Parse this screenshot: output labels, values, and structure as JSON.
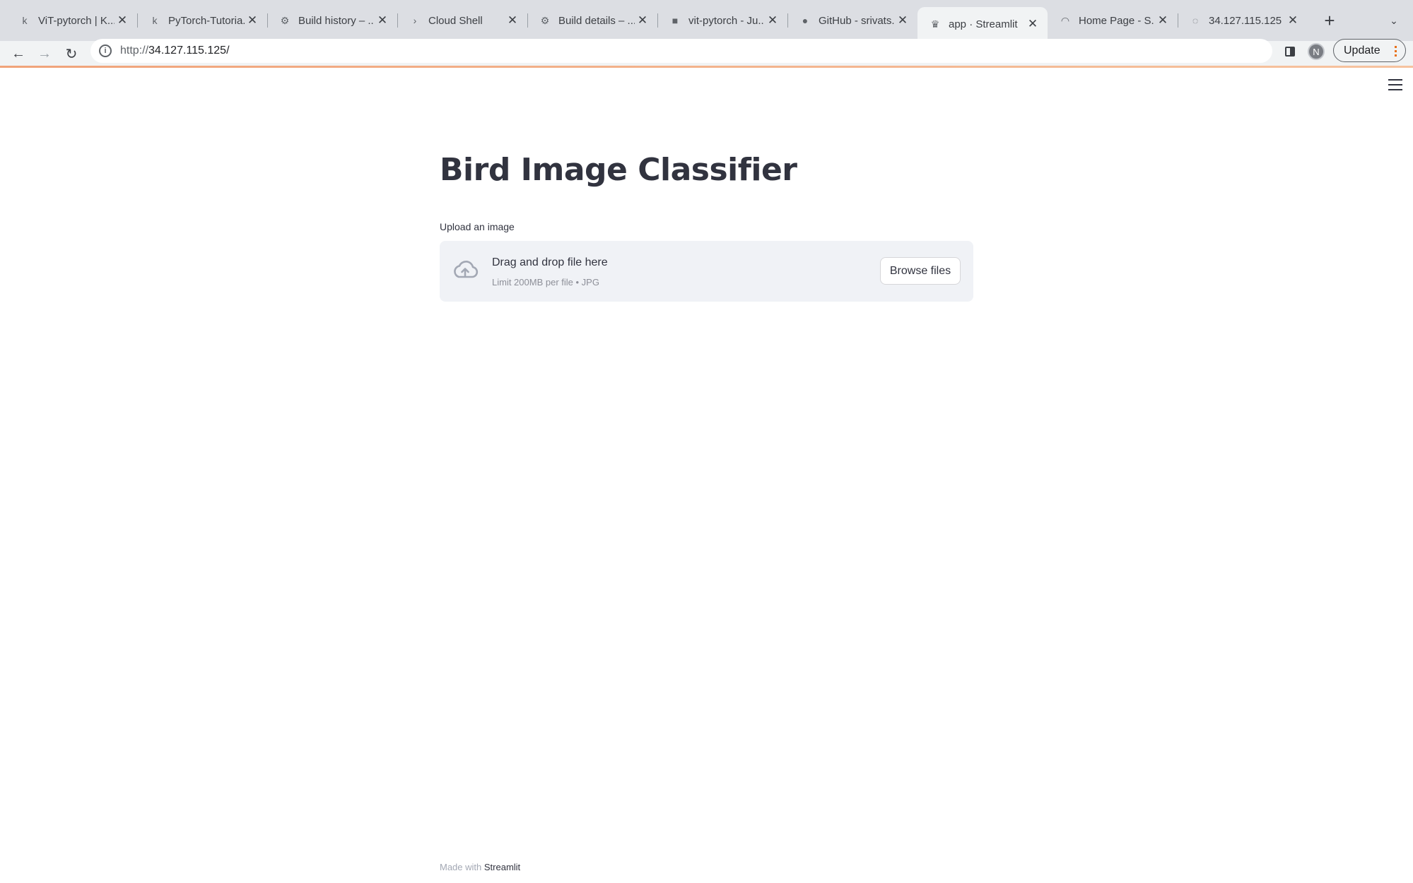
{
  "browser": {
    "tabs": [
      {
        "title": "ViT-pytorch | K...",
        "favicon": "k"
      },
      {
        "title": "PyTorch-Tutoria...",
        "favicon": "k"
      },
      {
        "title": "Build history – ...",
        "favicon": "⚙"
      },
      {
        "title": "Cloud Shell",
        "favicon": "›"
      },
      {
        "title": "Build details – ...",
        "favicon": "⚙"
      },
      {
        "title": "vit-pytorch - Ju...",
        "favicon": "■"
      },
      {
        "title": "GitHub - srivats...",
        "favicon": "●"
      },
      {
        "title": "app · Streamlit",
        "favicon": "♛"
      },
      {
        "title": "Home Page - S...",
        "favicon": "◠"
      },
      {
        "title": "34.127.115.125",
        "favicon": "◌"
      }
    ],
    "active_tab_index": 7,
    "new_tab_symbol": "+",
    "tab_menu_symbol": "⌄",
    "url_scheme": "http://",
    "url_host": "34.127.115.125/",
    "profile_initial": "N",
    "update_label": "Update",
    "colors": {
      "tabstrip": "#dcdee3",
      "toolbar": "#f1f3f4",
      "accent": "#e8711a"
    }
  },
  "app": {
    "title": "Bird Image Classifier",
    "uploader": {
      "label": "Upload an image",
      "drop_title": "Drag and drop file here",
      "drop_subtitle": "Limit 200MB per file • JPG",
      "browse_label": "Browse files"
    },
    "footer": {
      "prefix": "Made with ",
      "brand": "Streamlit"
    }
  }
}
